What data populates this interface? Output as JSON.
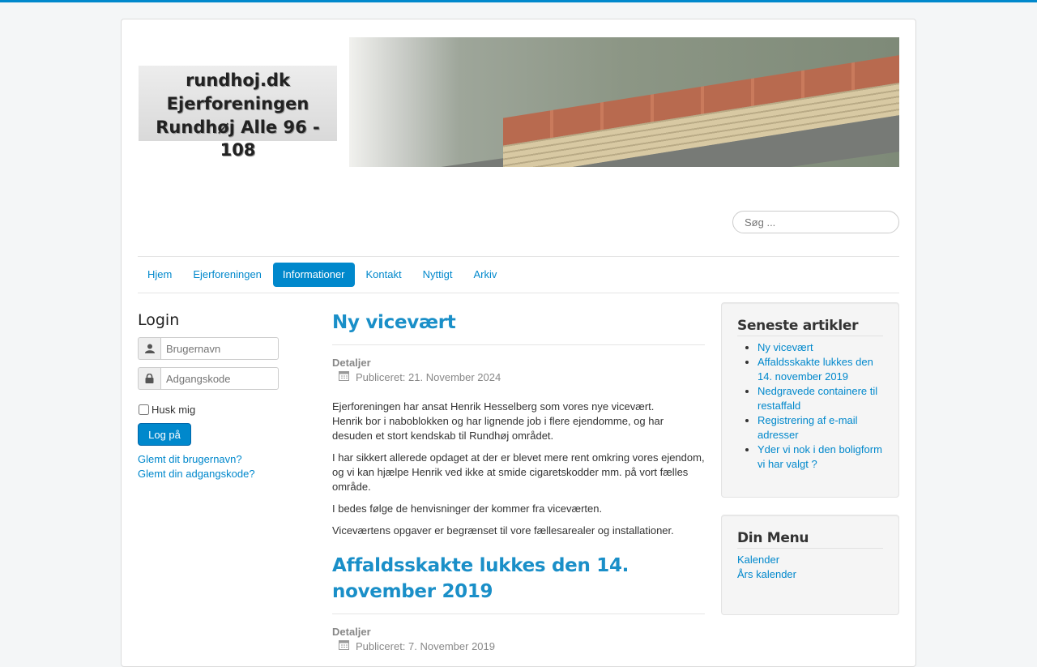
{
  "header": {
    "logo_lines": [
      "rundhoj.dk",
      "Ejerforeningen",
      "Rundhøj Alle 96 - 108"
    ],
    "search_placeholder": "Søg ..."
  },
  "nav": [
    {
      "label": "Hjem",
      "active": false
    },
    {
      "label": "Ejerforeningen",
      "active": false
    },
    {
      "label": "Informationer",
      "active": true
    },
    {
      "label": "Kontakt",
      "active": false
    },
    {
      "label": "Nyttigt",
      "active": false
    },
    {
      "label": "Arkiv",
      "active": false
    }
  ],
  "login": {
    "title": "Login",
    "username_placeholder": "Brugernavn",
    "password_placeholder": "Adgangskode",
    "remember_label": "Husk mig",
    "submit_label": "Log på",
    "forgot_username": "Glemt dit brugernavn?",
    "forgot_password": "Glemt din adgangskode?"
  },
  "articles": [
    {
      "title": "Ny vicevært",
      "details_label": "Detaljer",
      "published": "Publiceret: 21. November 2024",
      "paragraphs": [
        "Ejerforeningen har ansat Henrik Hesselberg som vores nye vicevært.\nHenrik bor i naboblokken og har lignende job i flere ejendomme, og har desuden et stort kendskab til Rundhøj området.",
        "I har sikkert allerede opdaget at der er blevet mere rent omkring vores ejendom, og vi kan hjælpe Henrik ved ikke at smide cigaretskodder mm. på vort fælles område.",
        "I bedes følge de henvisninger der kommer fra viceværten.",
        "Viceværtens opgaver er begrænset til vore fællesarealer og installationer."
      ]
    },
    {
      "title": "Affaldsskakte lukkes den 14. november 2019",
      "details_label": "Detaljer",
      "published": "Publiceret: 7. November 2019",
      "paragraphs": []
    }
  ],
  "latest": {
    "title": "Seneste artikler",
    "items": [
      "Ny vicevært",
      "Affaldsskakte lukkes den 14. november 2019",
      "Nedgravede containere til restaffald",
      "Registrering af e-mail adresser",
      "Yder vi nok i den boligform vi har valgt ?"
    ]
  },
  "din_menu": {
    "title": "Din Menu",
    "items": [
      "Kalender",
      "Års kalender"
    ]
  },
  "colors": {
    "accent": "#0088cc",
    "title": "#1a8fc8"
  }
}
